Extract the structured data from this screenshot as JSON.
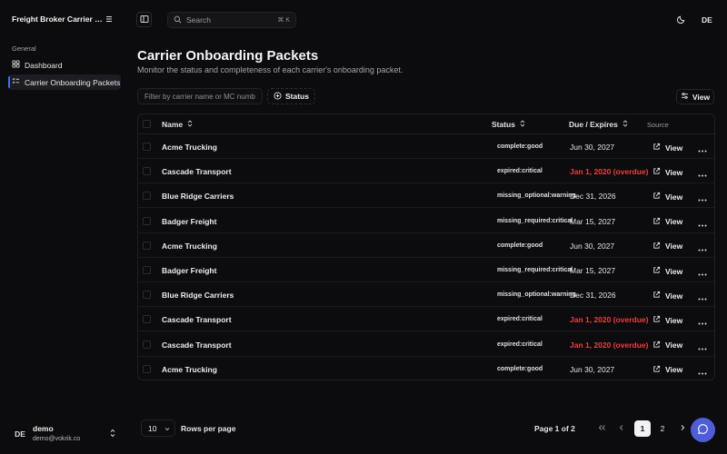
{
  "app": {
    "title": "Freight Broker Carrier Onboarding"
  },
  "sidebar": {
    "group_label": "General",
    "items": [
      {
        "label": "Dashboard",
        "icon": "dashboard-icon",
        "active": false
      },
      {
        "label": "Carrier Onboarding Packets",
        "icon": "list-checks-icon",
        "active": true
      }
    ],
    "user": {
      "initials": "DE",
      "name": "demo",
      "email": "demo@vokrik.co"
    }
  },
  "topbar": {
    "search_placeholder": "Search",
    "search_shortcut": "⌘ K",
    "avatar_initials": "DE"
  },
  "page": {
    "title": "Carrier Onboarding Packets",
    "subtitle": "Monitor the status and completeness of each carrier's onboarding packet."
  },
  "toolbar": {
    "filter_placeholder": "Filter by carrier name or MC number...",
    "status_label": "Status",
    "view_label": "View"
  },
  "table": {
    "columns": {
      "name": "Name",
      "status": "Status",
      "due": "Due / Expires",
      "source": "Source"
    },
    "view_label": "View",
    "rows": [
      {
        "name": "Acme Trucking",
        "status": "complete:good",
        "due": "Jun 30, 2027",
        "overdue": false
      },
      {
        "name": "Cascade Transport",
        "status": "expired:critical",
        "due": "Jan 1, 2020 (overdue)",
        "overdue": true
      },
      {
        "name": "Blue Ridge Carriers",
        "status": "missing_optional:warning",
        "due": "Dec 31, 2026",
        "overdue": false
      },
      {
        "name": "Badger Freight",
        "status": "missing_required:critical",
        "due": "Mar 15, 2027",
        "overdue": false
      },
      {
        "name": "Acme Trucking",
        "status": "complete:good",
        "due": "Jun 30, 2027",
        "overdue": false
      },
      {
        "name": "Badger Freight",
        "status": "missing_required:critical",
        "due": "Mar 15, 2027",
        "overdue": false
      },
      {
        "name": "Blue Ridge Carriers",
        "status": "missing_optional:warning",
        "due": "Dec 31, 2026",
        "overdue": false
      },
      {
        "name": "Cascade Transport",
        "status": "expired:critical",
        "due": "Jan 1, 2020 (overdue)",
        "overdue": true
      },
      {
        "name": "Cascade Transport",
        "status": "expired:critical",
        "due": "Jan 1, 2020 (overdue)",
        "overdue": true
      },
      {
        "name": "Acme Trucking",
        "status": "complete:good",
        "due": "Jun 30, 2027",
        "overdue": false
      }
    ]
  },
  "pagination": {
    "rows_per_page_value": "10",
    "rows_per_page_label": "Rows per page",
    "page_info": "Page 1 of 2",
    "pages": [
      "1",
      "2"
    ],
    "current_page": "1"
  },
  "colors": {
    "accent": "#3b6cff",
    "overdue": "#ef3e3e",
    "fab": "#4f5dd8"
  }
}
